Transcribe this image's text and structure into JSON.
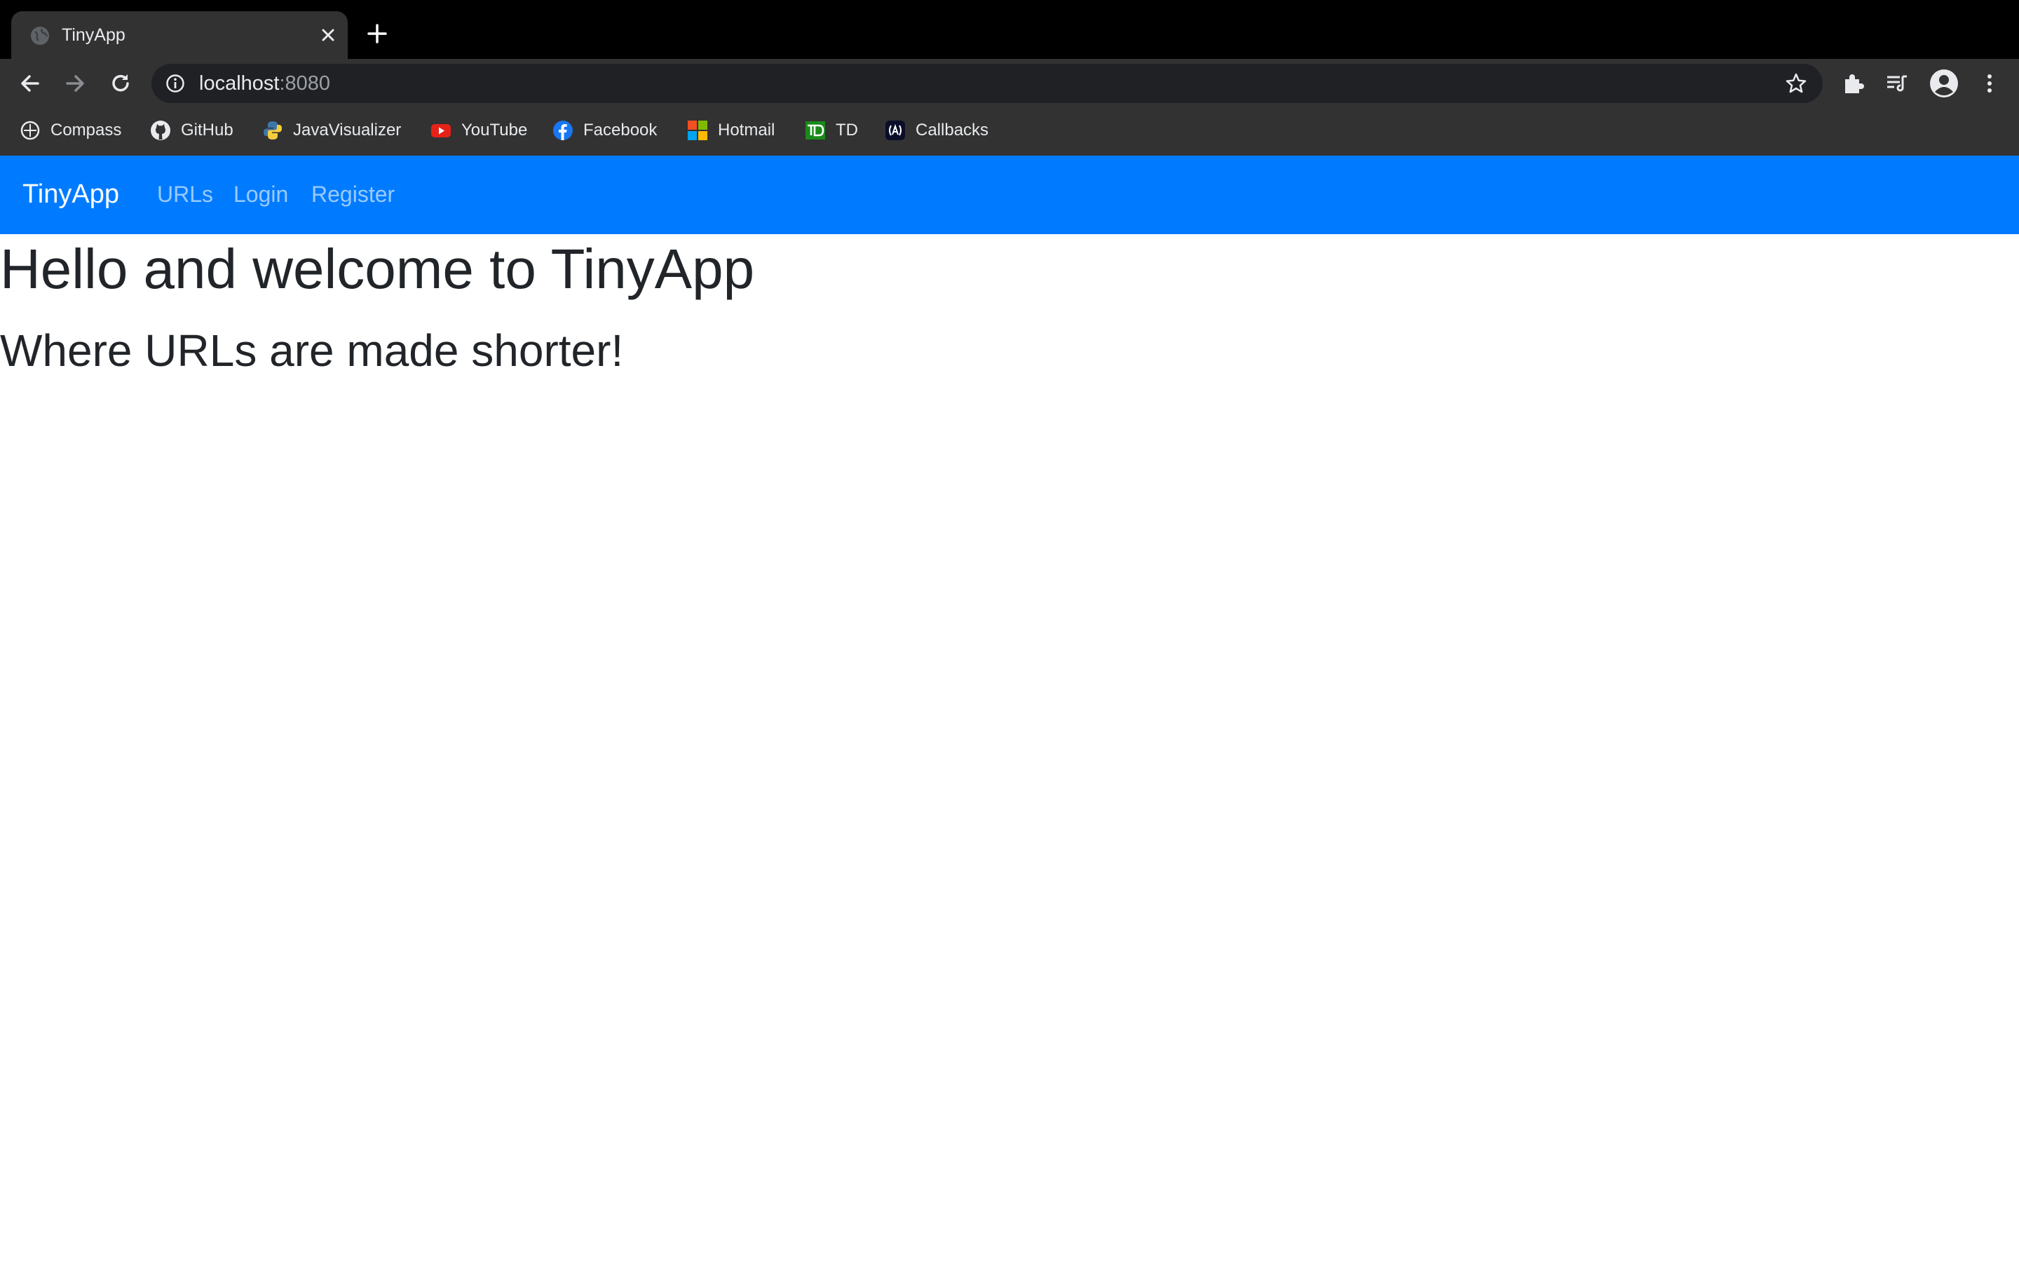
{
  "browser": {
    "tab": {
      "title": "TinyApp"
    },
    "address": {
      "host": "localhost",
      "port": ":8080"
    },
    "bookmarks": [
      {
        "label": "Compass",
        "icon": "compass-icon"
      },
      {
        "label": "GitHub",
        "icon": "github-icon"
      },
      {
        "label": "JavaVisualizer",
        "icon": "python-icon"
      },
      {
        "label": "YouTube",
        "icon": "youtube-icon"
      },
      {
        "label": "Facebook",
        "icon": "facebook-icon"
      },
      {
        "label": "Hotmail",
        "icon": "microsoft-icon"
      },
      {
        "label": "TD",
        "icon": "td-icon"
      },
      {
        "label": "Callbacks",
        "icon": "callbacks-icon"
      }
    ]
  },
  "navbar": {
    "brand": "TinyApp",
    "links": [
      "URLs",
      "Login",
      "Register"
    ],
    "color": "#007bff"
  },
  "main": {
    "heading": "Hello and welcome to TinyApp",
    "subheading": "Where URLs are made shorter!"
  }
}
